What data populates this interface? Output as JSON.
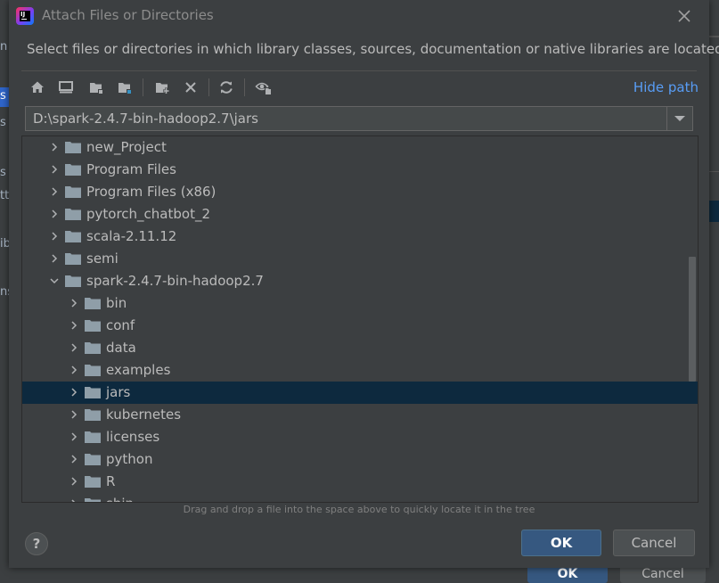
{
  "window": {
    "title": "Attach Files or Directories",
    "description": "Select files or directories in which library classes, sources, documentation or native libraries are located"
  },
  "toolbar": {
    "icons": [
      "home-icon",
      "desktop-icon",
      "project-folder-icon",
      "module-folder-icon",
      "new-folder-icon",
      "delete-icon",
      "refresh-icon",
      "show-hidden-icon"
    ],
    "hide_path_label": "Hide path"
  },
  "path": {
    "value": "D:\\spark-2.4.7-bin-hadoop2.7\\jars"
  },
  "tree": {
    "items": [
      {
        "label": "new_Project",
        "level": 0,
        "expanded": false,
        "selected": false
      },
      {
        "label": "Program Files",
        "level": 0,
        "expanded": false,
        "selected": false
      },
      {
        "label": "Program Files (x86)",
        "level": 0,
        "expanded": false,
        "selected": false
      },
      {
        "label": "pytorch_chatbot_2",
        "level": 0,
        "expanded": false,
        "selected": false
      },
      {
        "label": "scala-2.11.12",
        "level": 0,
        "expanded": false,
        "selected": false
      },
      {
        "label": "semi",
        "level": 0,
        "expanded": false,
        "selected": false
      },
      {
        "label": "spark-2.4.7-bin-hadoop2.7",
        "level": 0,
        "expanded": true,
        "selected": false
      },
      {
        "label": "bin",
        "level": 1,
        "expanded": false,
        "selected": false
      },
      {
        "label": "conf",
        "level": 1,
        "expanded": false,
        "selected": false
      },
      {
        "label": "data",
        "level": 1,
        "expanded": false,
        "selected": false
      },
      {
        "label": "examples",
        "level": 1,
        "expanded": false,
        "selected": false
      },
      {
        "label": "jars",
        "level": 1,
        "expanded": false,
        "selected": true
      },
      {
        "label": "kubernetes",
        "level": 1,
        "expanded": false,
        "selected": false
      },
      {
        "label": "licenses",
        "level": 1,
        "expanded": false,
        "selected": false
      },
      {
        "label": "python",
        "level": 1,
        "expanded": false,
        "selected": false
      },
      {
        "label": "R",
        "level": 1,
        "expanded": false,
        "selected": false
      },
      {
        "label": "sbin",
        "level": 1,
        "expanded": false,
        "selected": false
      }
    ]
  },
  "hint": "Drag and drop a file into the space above to quickly locate it in the tree",
  "buttons": {
    "help": "?",
    "ok": "OK",
    "cancel": "Cancel"
  },
  "background": {
    "left_fragments": [
      "n",
      "s",
      "s",
      "s",
      "tti",
      "ib",
      "ns"
    ],
    "bottom_ok": "OK",
    "bottom_cancel": "Cancel"
  },
  "colors": {
    "background": "#3c3f41",
    "selection": "#0d293e",
    "accent_link": "#589df6",
    "ok_button": "#365880",
    "folder": "#8f9ea8"
  }
}
